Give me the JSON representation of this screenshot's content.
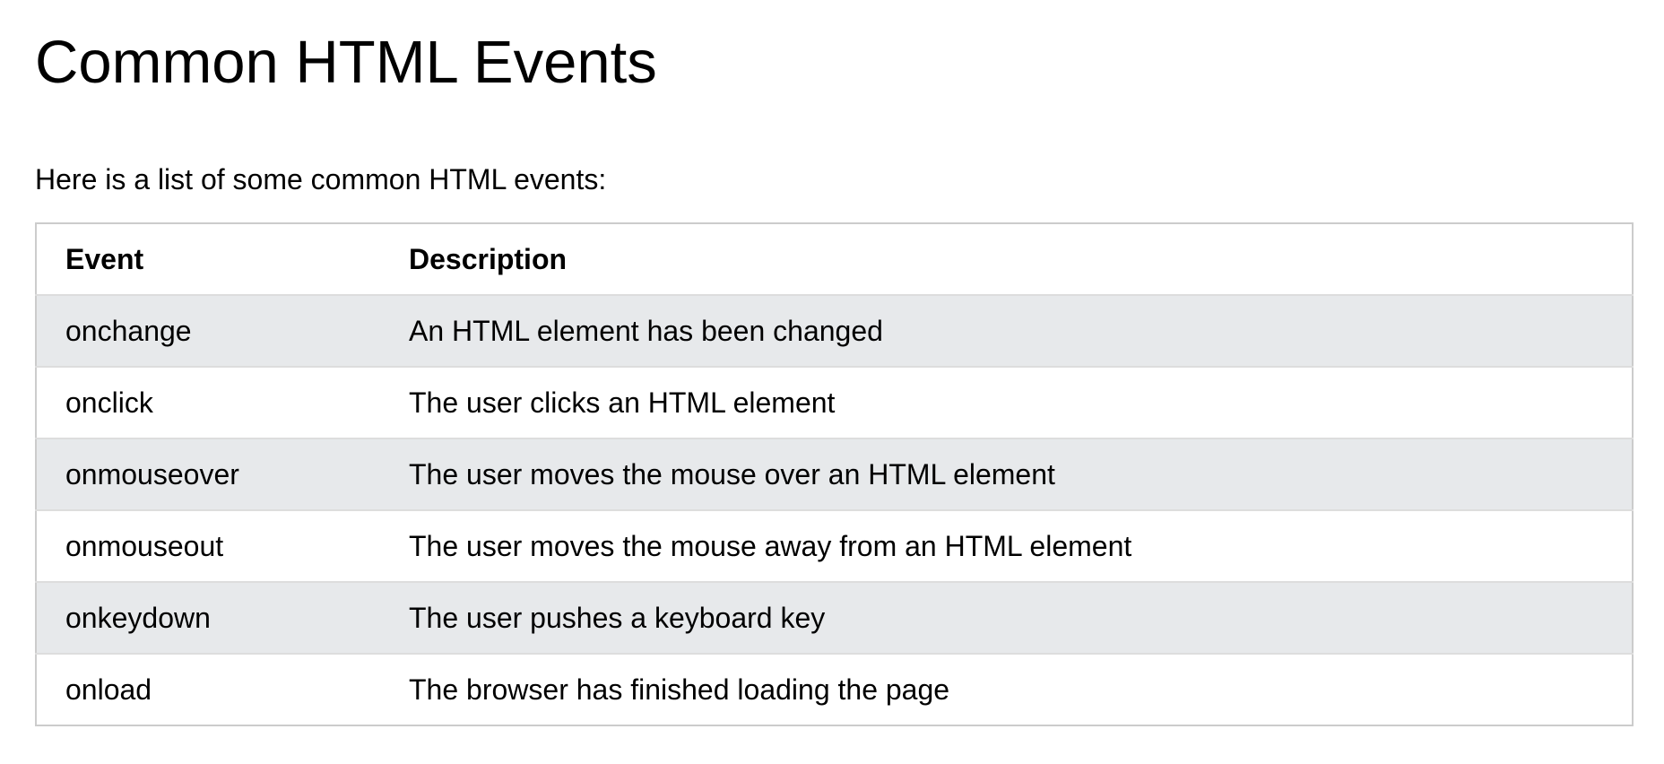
{
  "page": {
    "title": "Common HTML Events",
    "intro": "Here is a list of some common HTML events:"
  },
  "table": {
    "headers": {
      "event": "Event",
      "description": "Description"
    },
    "rows": [
      {
        "event": "onchange",
        "description": "An HTML element has been changed"
      },
      {
        "event": "onclick",
        "description": "The user clicks an HTML element"
      },
      {
        "event": "onmouseover",
        "description": "The user moves the mouse over an HTML element"
      },
      {
        "event": "onmouseout",
        "description": "The user moves the mouse away from an HTML element"
      },
      {
        "event": "onkeydown",
        "description": "The user pushes a keyboard key"
      },
      {
        "event": "onload",
        "description": "The browser has finished loading the page"
      }
    ]
  },
  "colors": {
    "stripe": "#e7e9eb",
    "border": "#cccccc"
  }
}
